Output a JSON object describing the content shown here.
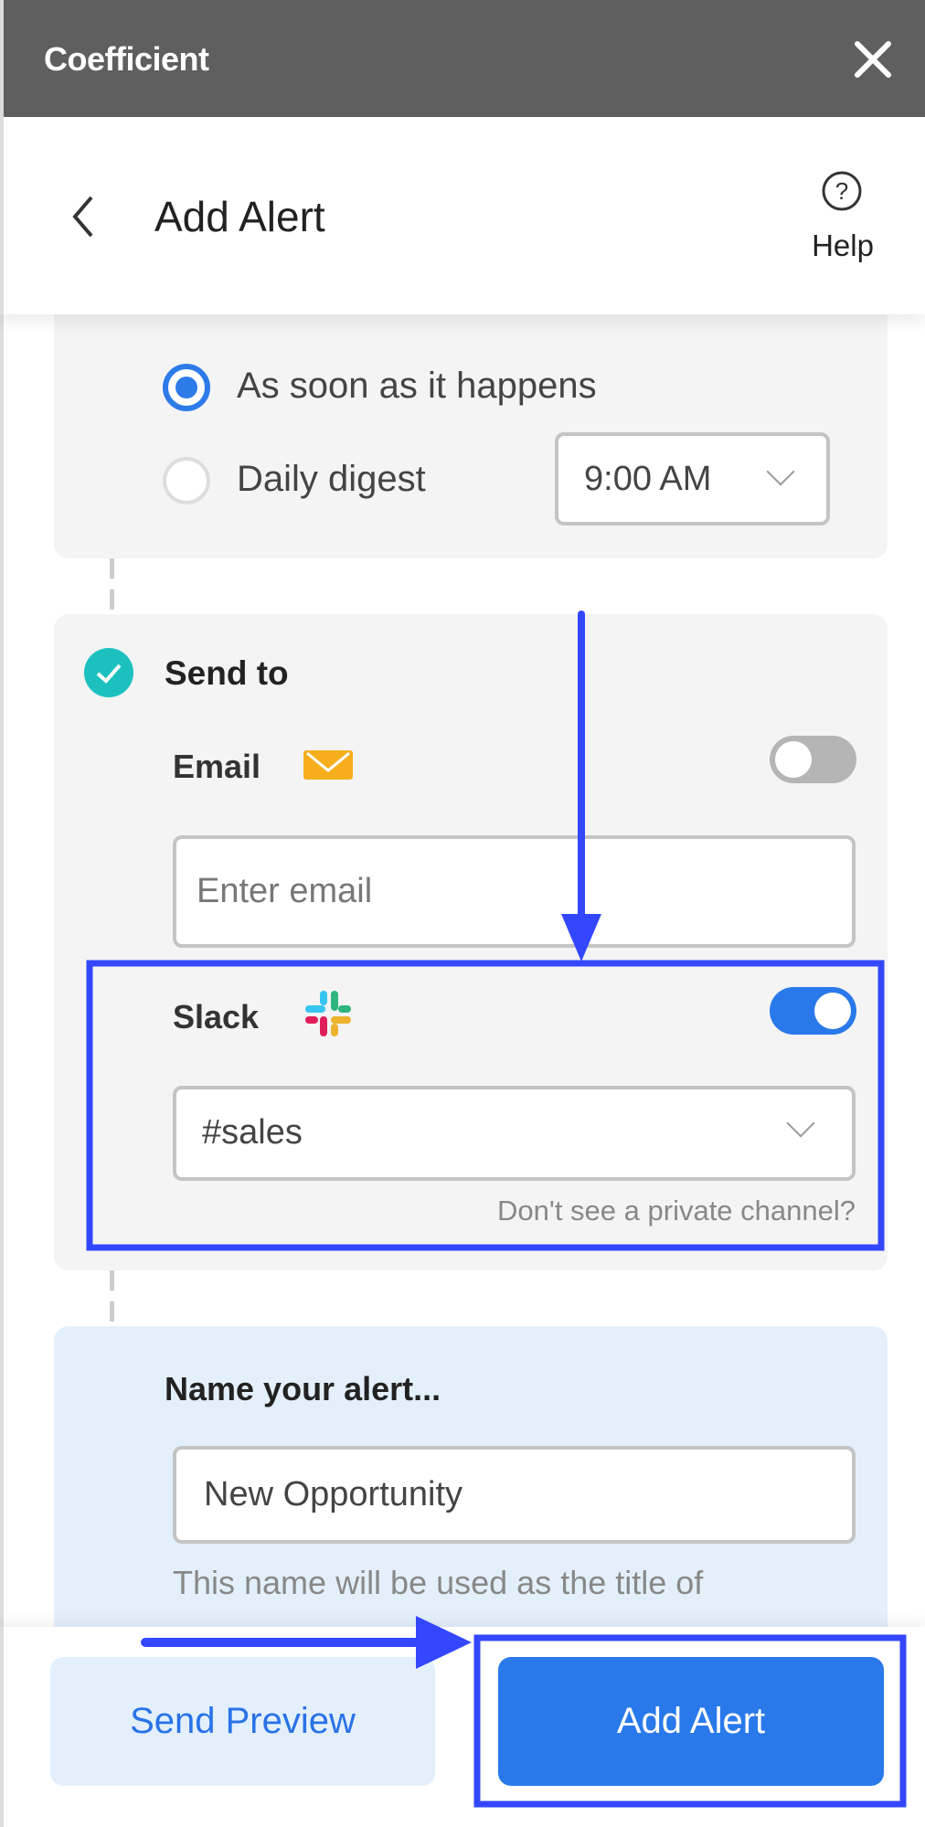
{
  "app": {
    "title": "Coefficient"
  },
  "header": {
    "title": "Add Alert",
    "help_label": "Help"
  },
  "frequency": {
    "options": [
      {
        "label": "As soon as it happens",
        "selected": true
      },
      {
        "label": "Daily digest",
        "selected": false
      }
    ],
    "time": "9:00 AM"
  },
  "send_to": {
    "title": "Send to",
    "email": {
      "label": "Email",
      "enabled": false,
      "placeholder": "Enter email"
    },
    "slack": {
      "label": "Slack",
      "enabled": true,
      "channel": "#sales",
      "help_link": "Don't see a private channel?"
    }
  },
  "name_section": {
    "title": "Name your alert...",
    "value": "New Opportunity",
    "helper": "This name will be used as the title of"
  },
  "footer": {
    "send_preview": "Send Preview",
    "add_alert": "Add Alert"
  },
  "colors": {
    "primary": "#2979ea",
    "annotation": "#3347ff",
    "check": "#1cc1bf",
    "email_icon": "#f7ae1d"
  }
}
